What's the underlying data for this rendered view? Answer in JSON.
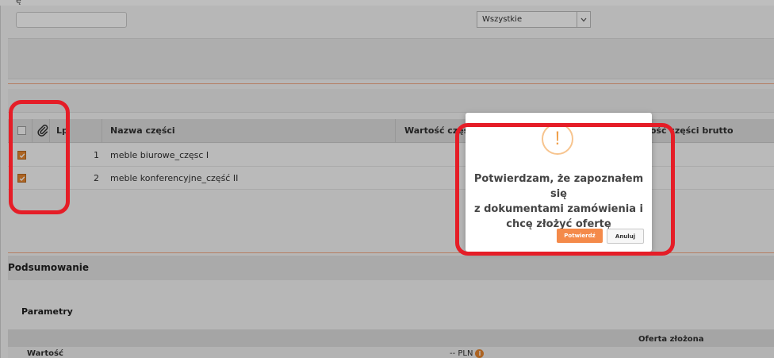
{
  "page": {
    "top_glyph": "ę"
  },
  "filters": {
    "select_value": "Wszystkie"
  },
  "table": {
    "columns": {
      "lp": "Lp",
      "name": "Nazwa części",
      "value": "Wartość częś",
      "value_brutto": "Wartość części brutto"
    },
    "rows": [
      {
        "num": "1",
        "name": "meble biurowe_częsc I",
        "checked": true
      },
      {
        "num": "2",
        "name": "meble konferencyjne_część II",
        "checked": true
      }
    ]
  },
  "summary": {
    "title": "Podsumowanie",
    "params_title": "Parametry",
    "offer_col": "Oferta złożona",
    "value_label": "Wartość",
    "value_display": "-- PLN",
    "info_symbol": "i"
  },
  "modal": {
    "icon_symbol": "!",
    "message_lines": [
      "Potwierdzam, że zapoznałem się",
      "z dokumentami zamówienia i",
      "chcę złożyć ofertę"
    ],
    "confirm_label": "Potwierdź",
    "cancel_label": "Anuluj"
  },
  "colors": {
    "accent": "#e67e22",
    "confirm": "#f48a4a",
    "highlight": "#e51d27",
    "warning_ring": "#f7c48e"
  }
}
